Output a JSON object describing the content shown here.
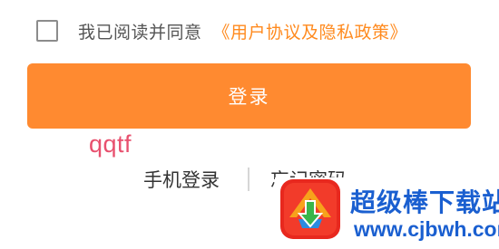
{
  "agreement": {
    "text": "我已阅读并同意",
    "link": "《用户协议及隐私政策》",
    "checked": false
  },
  "login_button": {
    "label": "登录"
  },
  "watermark": {
    "text": "qqtf"
  },
  "links": {
    "phone_login": "手机登录",
    "forgot_password": "忘记密码"
  },
  "logo": {
    "title": "超级棒下载站",
    "url": "www.cjbwh.com"
  },
  "colors": {
    "accent": "#ff8a30",
    "link": "#ff8a1e",
    "logo_blue": "#1a5fd0",
    "watermark": "#e8506e"
  }
}
